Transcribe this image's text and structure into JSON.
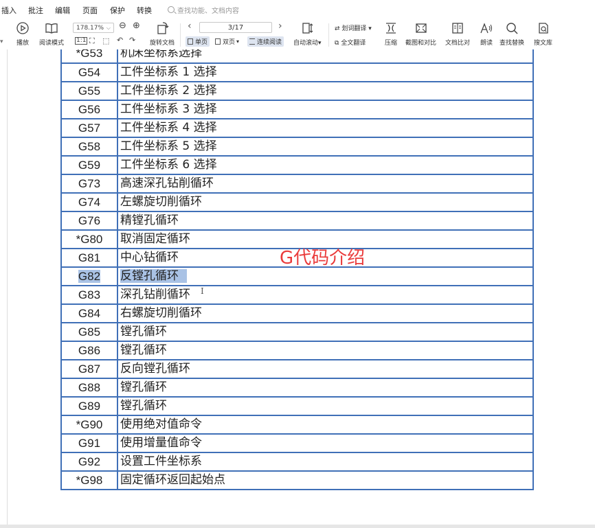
{
  "menu": {
    "items": [
      "插入",
      "批注",
      "编辑",
      "页面",
      "保护",
      "转换"
    ],
    "search_placeholder": "查找功能、文档内容"
  },
  "toolbar": {
    "play": "播放",
    "read_mode": "阅读模式",
    "zoom": "178.17%",
    "rotate": "旋转文档",
    "page": "3/17",
    "single_page": "单页",
    "double_page": "双页",
    "continuous": "连续阅读",
    "auto_scroll": "自动滚动",
    "word_translate": "划词翻译",
    "full_translate": "全文翻译",
    "compress": "压缩",
    "screenshot_compare": "截图和对比",
    "doc_compare": "文档比对",
    "read_aloud": "朗读",
    "find_replace": "查找替换",
    "search_library": "搜文库"
  },
  "document": {
    "overlay_title": "G代码介绍",
    "rows": [
      {
        "code": "*G53",
        "desc": "机床坐标系选择"
      },
      {
        "code": "G54",
        "desc": "工件坐标系 1 选择"
      },
      {
        "code": "G55",
        "desc": "工件坐标系 2 选择"
      },
      {
        "code": "G56",
        "desc": "工件坐标系 3 选择"
      },
      {
        "code": "G57",
        "desc": "工件坐标系 4 选择"
      },
      {
        "code": "G58",
        "desc": "工件坐标系 5 选择"
      },
      {
        "code": "G59",
        "desc": "工件坐标系 6 选择"
      },
      {
        "code": "G73",
        "desc": "高速深孔钻削循环"
      },
      {
        "code": "G74",
        "desc": "左螺旋切削循环"
      },
      {
        "code": "G76",
        "desc": "精镗孔循环"
      },
      {
        "code": "*G80",
        "desc": "取消固定循环"
      },
      {
        "code": "G81",
        "desc": "中心钻循环"
      },
      {
        "code": "G82",
        "desc": "反镗孔循环",
        "selected": true
      },
      {
        "code": "G83",
        "desc": "深孔钻削循环"
      },
      {
        "code": "G84",
        "desc": "右螺旋切削循环"
      },
      {
        "code": "G85",
        "desc": "镗孔循环"
      },
      {
        "code": "G86",
        "desc": "镗孔循环"
      },
      {
        "code": "G87",
        "desc": "反向镗孔循环"
      },
      {
        "code": "G88",
        "desc": "镗孔循环"
      },
      {
        "code": "G89",
        "desc": "镗孔循环"
      },
      {
        "code": "*G90",
        "desc": "使用绝对值命令"
      },
      {
        "code": "G91",
        "desc": "使用增量值命令"
      },
      {
        "code": "G92",
        "desc": "设置工件坐标系"
      },
      {
        "code": "*G98",
        "desc": "固定循环返回起始点"
      }
    ]
  },
  "colors": {
    "table_border": "#3f6fb7",
    "selection": "#a9c2e5",
    "overlay_title": "#ea3b3b"
  },
  "icons": [
    "play-icon",
    "book-icon",
    "zoom-out-icon",
    "zoom-in-icon",
    "rotate-doc-icon",
    "prev-page-icon",
    "next-page-icon",
    "auto-scroll-icon",
    "translate-icon",
    "compress-icon",
    "screenshot-icon",
    "compare-icon",
    "read-aloud-icon",
    "search-icon",
    "library-search-icon"
  ]
}
